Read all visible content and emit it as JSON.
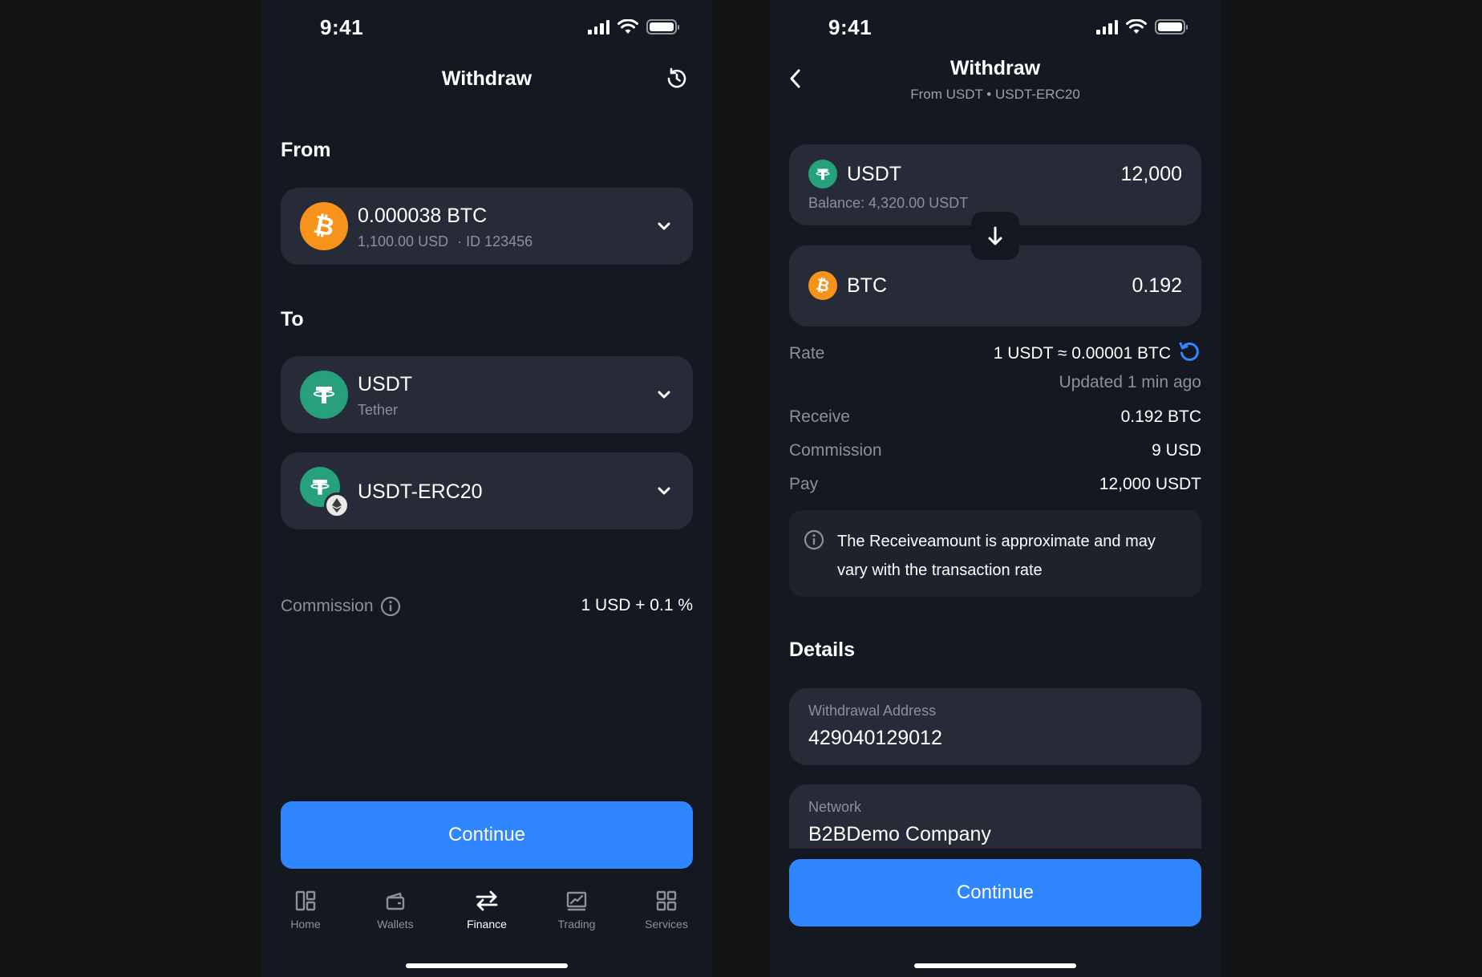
{
  "status_bar": {
    "time": "9:41"
  },
  "left": {
    "title": "Withdraw",
    "from_label": "From",
    "from_card": {
      "amount": "0.000038 BTC",
      "fiat": "1,100.00 USD",
      "account_id": "· ID 123456",
      "icon": "bitcoin-icon"
    },
    "to_label": "To",
    "to_asset": {
      "name": "USDT",
      "sub": "Tether",
      "icon": "tether-icon"
    },
    "to_network": {
      "name": "USDT-ERC20",
      "icon": "tether-icon",
      "badge_icon": "ethereum-icon"
    },
    "commission": {
      "label": "Commission",
      "value": "1 USD + 0.1 %"
    },
    "continue_label": "Continue",
    "tabs": [
      {
        "label": "Home",
        "icon": "dashboard-icon"
      },
      {
        "label": "Wallets",
        "icon": "wallet-icon"
      },
      {
        "label": "Finance",
        "icon": "transfer-arrows-icon",
        "active": true
      },
      {
        "label": "Trading",
        "icon": "chart-icon"
      },
      {
        "label": "Services",
        "icon": "grid-icon"
      }
    ]
  },
  "right": {
    "title": "Withdraw",
    "subtitle": "From USDT • USDT-ERC20",
    "from_asset": {
      "symbol": "USDT",
      "amount": "12,000",
      "balance": "Balance: 4,320.00 USDT"
    },
    "to_asset": {
      "symbol": "BTC",
      "amount": "0.192"
    },
    "rate": {
      "label": "Rate",
      "value": "1 USDT ≈ 0.00001 BTC",
      "updated": "Updated 1 min ago"
    },
    "receive": {
      "label": "Receive",
      "value": "0.192 BTC"
    },
    "commission": {
      "label": "Commission",
      "value": "9 USD"
    },
    "pay": {
      "label": "Pay",
      "value": "12,000 USDT"
    },
    "notice_line1": "The Receiveamount is approximate and may",
    "notice_line2": "vary with the transaction rate",
    "details_title": "Details",
    "withdrawal_address": {
      "label": "Withdrawal Address",
      "value": "429040129012"
    },
    "network": {
      "label": "Network",
      "value": "B2BDemo Company"
    },
    "continue_label": "Continue"
  },
  "colors": {
    "background": "#141821",
    "card": "#262b37",
    "accent": "#2f86ff",
    "btc": "#f7931a",
    "usdt": "#26a17b"
  }
}
